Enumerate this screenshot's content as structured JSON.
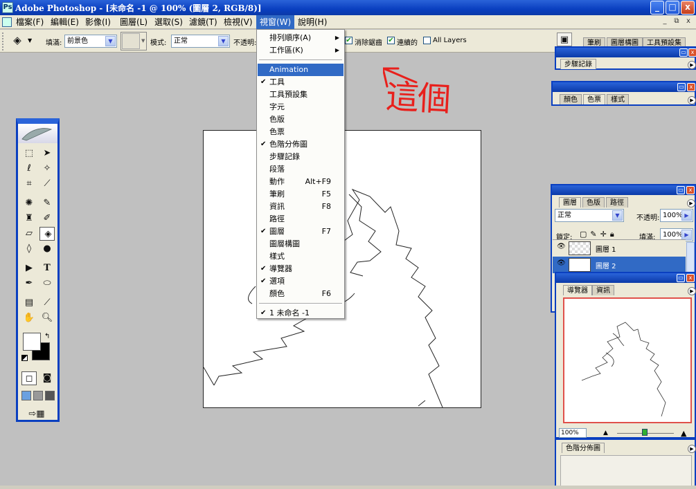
{
  "window": {
    "title": "Adobe Photoshop - [未命名 -1 @ 100% (圖層 2, RGB/8)]",
    "app_icon": "Ps"
  },
  "window_buttons": {
    "minimize": "_",
    "maximize": "□",
    "close": "x"
  },
  "mdi_buttons": {
    "minimize": "_",
    "restore": "⧉",
    "close": "x"
  },
  "menubar": [
    {
      "label": "檔案(F)"
    },
    {
      "label": "編輯(E)"
    },
    {
      "label": "影像(I)"
    },
    {
      "label": "圖層(L)"
    },
    {
      "label": "選取(S)"
    },
    {
      "label": "濾鏡(T)"
    },
    {
      "label": "檢視(V)"
    },
    {
      "label": "視窗(W)",
      "active": true
    },
    {
      "label": "說明(H)"
    }
  ],
  "options_bar": {
    "fill_label": "填滿:",
    "fill_value": "前景色",
    "mode_label": "模式:",
    "mode_value": "正常",
    "opacity_label": "不透明:",
    "antialias_label": "消除鋸齒",
    "contiguous_label": "連續的",
    "all_layers_label": "All Layers"
  },
  "window_menu": {
    "items": [
      {
        "label": "排列順序(A)",
        "submenu": true
      },
      {
        "label": "工作區(K)",
        "submenu": true
      },
      {
        "sep": true
      },
      {
        "label": "Animation",
        "highlighted": true
      },
      {
        "label": "工具",
        "checked": true
      },
      {
        "label": "工具預設集"
      },
      {
        "label": "字元"
      },
      {
        "label": "色版"
      },
      {
        "label": "色票"
      },
      {
        "label": "色階分佈圖",
        "checked": true
      },
      {
        "label": "步驟記錄"
      },
      {
        "label": "段落"
      },
      {
        "label": "動作",
        "shortcut": "Alt+F9"
      },
      {
        "label": "筆刷",
        "shortcut": "F5"
      },
      {
        "label": "資訊",
        "shortcut": "F8"
      },
      {
        "label": "路徑"
      },
      {
        "label": "圖層",
        "checked": true,
        "shortcut": "F7"
      },
      {
        "label": "圖層構圖"
      },
      {
        "label": "樣式"
      },
      {
        "label": "導覽器",
        "checked": true
      },
      {
        "label": "選項",
        "checked": true
      },
      {
        "label": "顏色",
        "shortcut": "F6"
      },
      {
        "sep": true
      },
      {
        "label": "1 未命名 -1",
        "checked": true
      }
    ]
  },
  "annotation": {
    "text": "這個",
    "color": "#e8201c"
  },
  "palettes": {
    "top_tabs": [
      "筆刷",
      "圖層構圖",
      "工具預設集"
    ],
    "history": {
      "tab": "步驟記錄"
    },
    "color": {
      "tabs": [
        "顏色",
        "色票",
        "樣式"
      ],
      "active": 1
    },
    "layers": {
      "tabs": [
        "圖層",
        "色版",
        "路徑"
      ],
      "active": 0,
      "blend_mode": "正常",
      "opacity_label": "不透明:",
      "opacity": "100%",
      "lock_label": "鎖定:",
      "fill_label": "填滿:",
      "fill": "100%",
      "layers": [
        {
          "name": "圖層 1",
          "selected": false
        },
        {
          "name": "圖層 2",
          "selected": true
        }
      ]
    },
    "navigator": {
      "tabs": [
        "導覽器",
        "資訊"
      ],
      "active": 0,
      "zoom": "100%"
    },
    "histogram": {
      "tab": "色階分佈圖"
    }
  },
  "colors": {
    "accent": "#316ac5",
    "title_blue": "#0a3fc0",
    "nav_frame": "#e0504a"
  }
}
